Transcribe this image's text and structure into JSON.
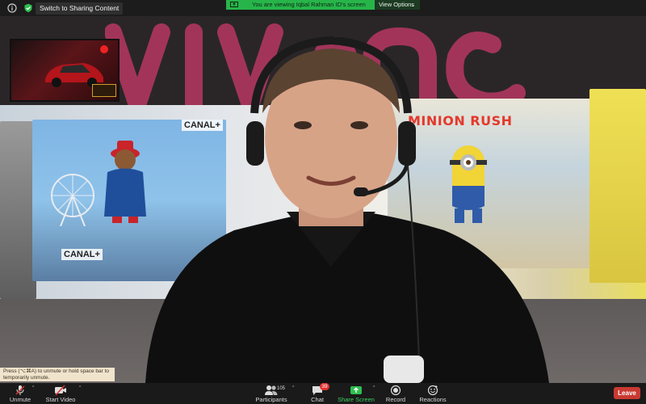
{
  "topbar": {
    "sharing_button_label": "Switch to Sharing Content",
    "banner_text": "You are viewing Iqbal Rahman ID's screen",
    "view_options_label": "View Options",
    "chevron_glyph": "⌄"
  },
  "stage": {
    "channel_tags": [
      "CANAL+",
      "CANAL+"
    ],
    "game_title": "MINION RUSH"
  },
  "tooltip": {
    "text": "Press (⌥⌘A) to unmute or hold space bar to temporarily unmute."
  },
  "toolbar": {
    "unmute_label": "Unmute",
    "start_video_label": "Start Video",
    "participants_label": "Participants",
    "participants_count": "105",
    "chat_label": "Chat",
    "chat_badge": "39",
    "share_screen_label": "Share Screen",
    "record_label": "Record",
    "reactions_label": "Reactions",
    "leave_label": "Leave",
    "caret_glyph": "^"
  },
  "colors": {
    "share_green": "#27b54a",
    "leave_red": "#c93a32",
    "toolbar_bg": "#1a1a1a"
  }
}
